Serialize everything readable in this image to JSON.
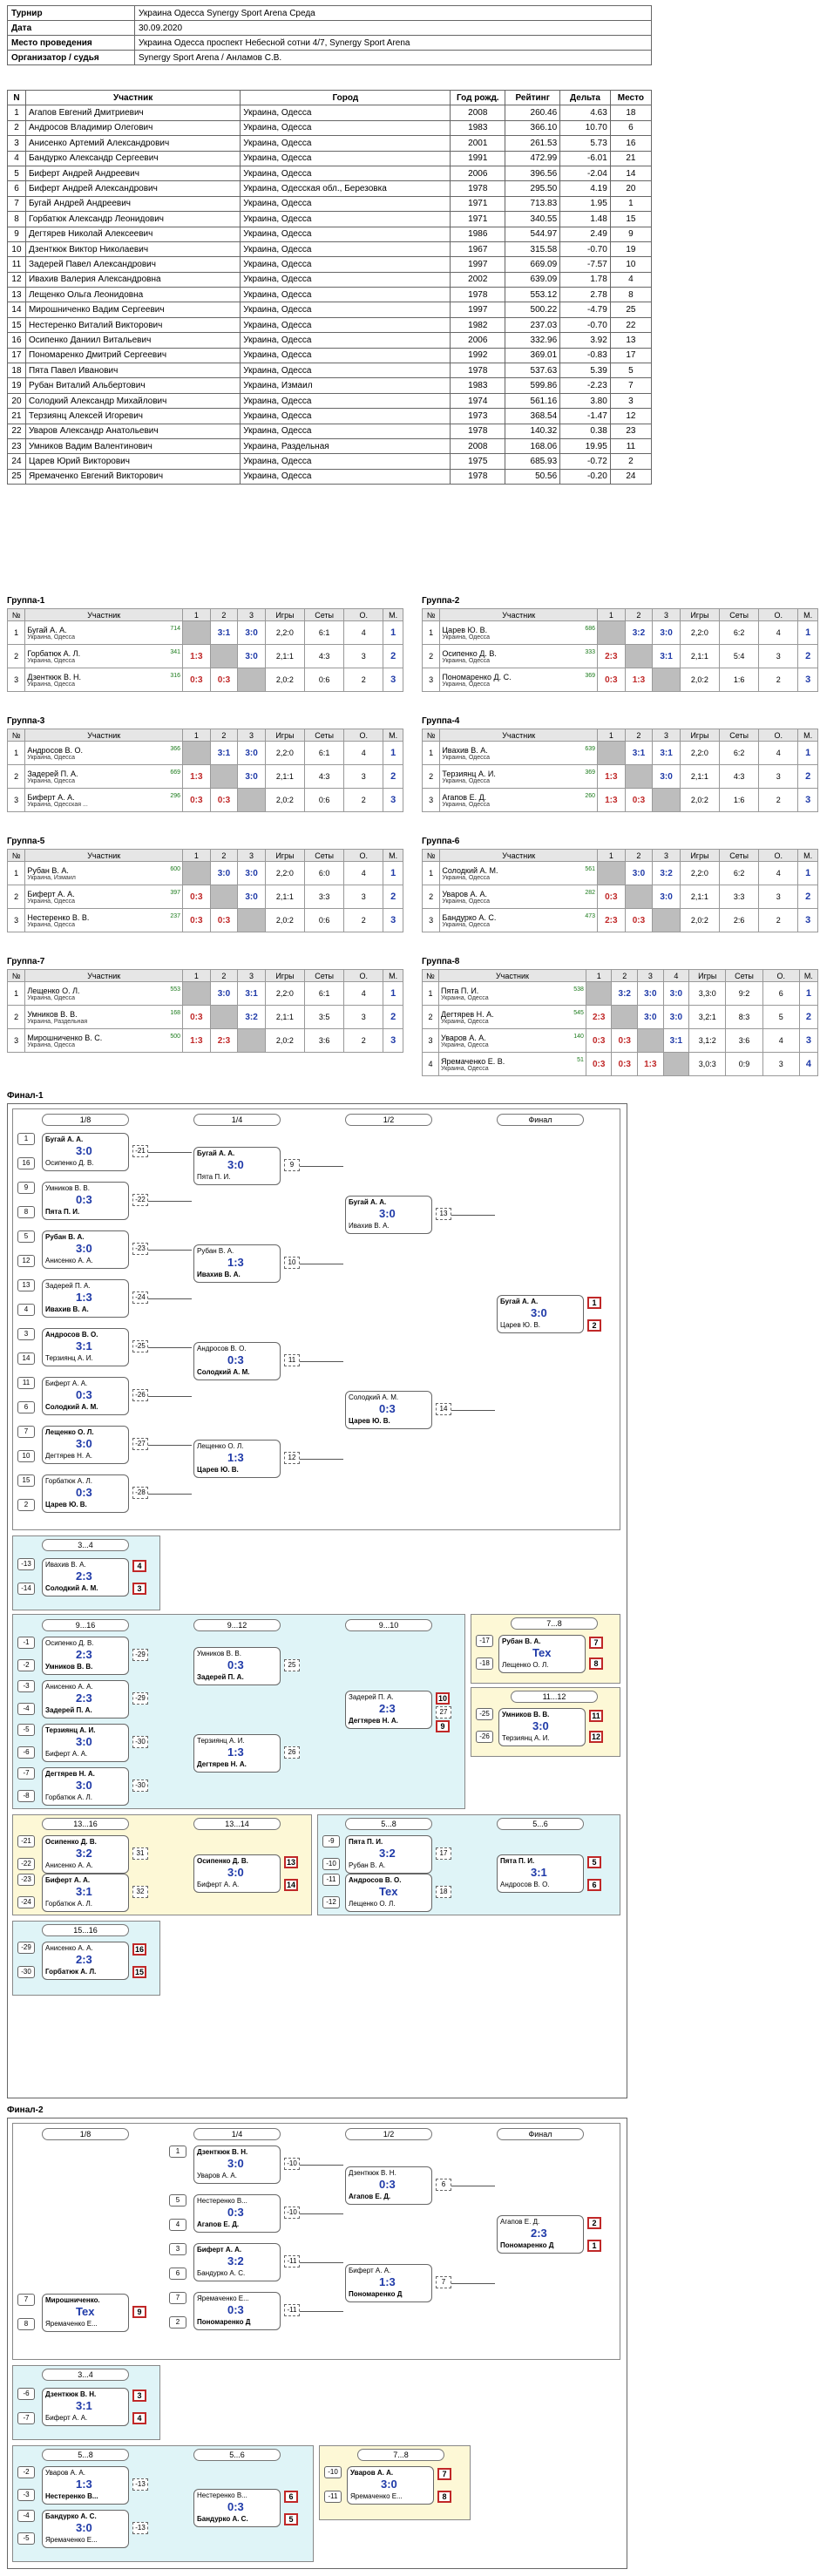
{
  "info": [
    {
      "k": "Турнир",
      "v": "Украина Одесса Synergy Sport Arena Среда"
    },
    {
      "k": "Дата",
      "v": "30.09.2020"
    },
    {
      "k": "Место проведения",
      "v": "Украина Одесса проспект Небесной сотни 4/7, Synergy Sport Arena"
    },
    {
      "k": "Организатор / судья",
      "v": "Synergy Sport Arena / Анламов С.В."
    }
  ],
  "table": {
    "headers": [
      "N",
      "Участник",
      "Город",
      "Год рожд.",
      "Рейтинг",
      "Дельта",
      "Место"
    ],
    "rows": [
      [
        "1",
        "Агапов Евгений Дмитриевич",
        "Украина, Одесса",
        "2008",
        "260.46",
        "4.63",
        "18"
      ],
      [
        "2",
        "Андросов Владимир Олегович",
        "Украина, Одесса",
        "1983",
        "366.10",
        "10.70",
        "6"
      ],
      [
        "3",
        "Анисенко Артемий Александрович",
        "Украина, Одесса",
        "2001",
        "261.53",
        "5.73",
        "16"
      ],
      [
        "4",
        "Бандурко Александр Сергеевич",
        "Украина, Одесса",
        "1991",
        "472.99",
        "-6.01",
        "21"
      ],
      [
        "5",
        "Биферт Андрей Андреевич",
        "Украина, Одесса",
        "2006",
        "396.56",
        "-2.04",
        "14"
      ],
      [
        "6",
        "Биферт Андрей Александрович",
        "Украина, Одесская обл., Березовка",
        "1978",
        "295.50",
        "4.19",
        "20"
      ],
      [
        "7",
        "Бугай Андрей Андреевич",
        "Украина, Одесса",
        "1971",
        "713.83",
        "1.95",
        "1"
      ],
      [
        "8",
        "Горбатюк Александр Леонидович",
        "Украина, Одесса",
        "1971",
        "340.55",
        "1.48",
        "15"
      ],
      [
        "9",
        "Дегтярев Николай Алексеевич",
        "Украина, Одесса",
        "1986",
        "544.97",
        "2.49",
        "9"
      ],
      [
        "10",
        "Дзенткюк Виктор Николаевич",
        "Украина, Одесса",
        "1967",
        "315.58",
        "-0.70",
        "19"
      ],
      [
        "11",
        "Задерей Павел Александрович",
        "Украина, Одесса",
        "1997",
        "669.09",
        "-7.57",
        "10"
      ],
      [
        "12",
        "Ивахив Валерия Александровна",
        "Украина, Одесса",
        "2002",
        "639.09",
        "1.78",
        "4"
      ],
      [
        "13",
        "Лещенко Ольга Леонидовна",
        "Украина, Одесса",
        "1978",
        "553.12",
        "2.78",
        "8"
      ],
      [
        "14",
        "Мирошниченко Вадим Сергеевич",
        "Украина, Одесса",
        "1997",
        "500.22",
        "-4.79",
        "25"
      ],
      [
        "15",
        "Нестеренко Виталий Викторович",
        "Украина, Одесса",
        "1982",
        "237.03",
        "-0.70",
        "22"
      ],
      [
        "16",
        "Осипенко Даниил Витальевич",
        "Украина, Одесса",
        "2006",
        "332.96",
        "3.92",
        "13"
      ],
      [
        "17",
        "Пономаренко Дмитрий Сергеевич",
        "Украина, Одесса",
        "1992",
        "369.01",
        "-0.83",
        "17"
      ],
      [
        "18",
        "Пята Павел Иванович",
        "Украина, Одесса",
        "1978",
        "537.63",
        "5.39",
        "5"
      ],
      [
        "19",
        "Рубан Виталий Альбертович",
        "Украина, Измаил",
        "1983",
        "599.86",
        "-2.23",
        "7"
      ],
      [
        "20",
        "Солодкий Александр Михайлович",
        "Украина, Одесса",
        "1974",
        "561.16",
        "3.80",
        "3"
      ],
      [
        "21",
        "Терзиянц Алексей Игоревич",
        "Украина, Одесса",
        "1973",
        "368.54",
        "-1.47",
        "12"
      ],
      [
        "22",
        "Уваров Александр Анатольевич",
        "Украина, Одесса",
        "1978",
        "140.32",
        "0.38",
        "23"
      ],
      [
        "23",
        "Умников Вадим Валентинович",
        "Украина, Раздельная",
        "2008",
        "168.06",
        "19.95",
        "11"
      ],
      [
        "24",
        "Царев Юрий Викторович",
        "Украина, Одесса",
        "1975",
        "685.93",
        "-0.72",
        "2"
      ],
      [
        "25",
        "Яремаченко Евгений Викторович",
        "Украина, Одесса",
        "1978",
        "50.56",
        "-0.20",
        "24"
      ]
    ]
  },
  "groups": [
    {
      "title": "Группа-1",
      "players": [
        {
          "n": "1",
          "name": "Бугай А. А.",
          "region": "Украина, Одесса",
          "rating": "714",
          "r": [
            "",
            "3:1",
            "3:0"
          ],
          "games": "2,2:0",
          "sets": "6:1",
          "pts": "4",
          "place": "1"
        },
        {
          "n": "2",
          "name": "Горбатюк А. Л.",
          "region": "Украина, Одесса",
          "rating": "341",
          "r": [
            "1:3",
            "",
            "3:0"
          ],
          "games": "2,1:1",
          "sets": "4:3",
          "pts": "3",
          "place": "2"
        },
        {
          "n": "3",
          "name": "Дзенткюк В. Н.",
          "region": "Украина, Одесса",
          "rating": "316",
          "r": [
            "0:3",
            "0:3",
            ""
          ],
          "games": "2,0:2",
          "sets": "0:6",
          "pts": "2",
          "place": "3"
        }
      ]
    },
    {
      "title": "Группа-2",
      "players": [
        {
          "n": "1",
          "name": "Царев Ю. В.",
          "region": "Украина, Одесса",
          "rating": "686",
          "r": [
            "",
            "3:2",
            "3:0"
          ],
          "games": "2,2:0",
          "sets": "6:2",
          "pts": "4",
          "place": "1"
        },
        {
          "n": "2",
          "name": "Осипенко Д. В.",
          "region": "Украина, Одесса",
          "rating": "333",
          "r": [
            "2:3",
            "",
            "3:1"
          ],
          "games": "2,1:1",
          "sets": "5:4",
          "pts": "3",
          "place": "2"
        },
        {
          "n": "3",
          "name": "Пономаренко Д. С.",
          "region": "Украина, Одесса",
          "rating": "369",
          "r": [
            "0:3",
            "1:3",
            ""
          ],
          "games": "2,0:2",
          "sets": "1:6",
          "pts": "2",
          "place": "3"
        }
      ]
    },
    {
      "title": "Группа-3",
      "players": [
        {
          "n": "1",
          "name": "Андросов В. О.",
          "region": "Украина, Одесса",
          "rating": "366",
          "r": [
            "",
            "3:1",
            "3:0"
          ],
          "games": "2,2:0",
          "sets": "6:1",
          "pts": "4",
          "place": "1"
        },
        {
          "n": "2",
          "name": "Задерей П. А.",
          "region": "Украина, Одесса",
          "rating": "669",
          "r": [
            "1:3",
            "",
            "3:0"
          ],
          "games": "2,1:1",
          "sets": "4:3",
          "pts": "3",
          "place": "2"
        },
        {
          "n": "3",
          "name": "Биферт А. А.",
          "region": "Украина, Одесская ...",
          "rating": "296",
          "r": [
            "0:3",
            "0:3",
            ""
          ],
          "games": "2,0:2",
          "sets": "0:6",
          "pts": "2",
          "place": "3"
        }
      ]
    },
    {
      "title": "Группа-4",
      "players": [
        {
          "n": "1",
          "name": "Ивахив В. А.",
          "region": "Украина, Одесса",
          "rating": "639",
          "r": [
            "",
            "3:1",
            "3:1"
          ],
          "games": "2,2:0",
          "sets": "6:2",
          "pts": "4",
          "place": "1"
        },
        {
          "n": "2",
          "name": "Терзиянц А. И.",
          "region": "Украина, Одесса",
          "rating": "369",
          "r": [
            "1:3",
            "",
            "3:0"
          ],
          "games": "2,1:1",
          "sets": "4:3",
          "pts": "3",
          "place": "2"
        },
        {
          "n": "3",
          "name": "Агапов Е. Д.",
          "region": "Украина, Одесса",
          "rating": "260",
          "r": [
            "1:3",
            "0:3",
            ""
          ],
          "games": "2,0:2",
          "sets": "1:6",
          "pts": "2",
          "place": "3"
        }
      ]
    },
    {
      "title": "Группа-5",
      "players": [
        {
          "n": "1",
          "name": "Рубан В. А.",
          "region": "Украина, Измаил",
          "rating": "600",
          "r": [
            "",
            "3:0",
            "3:0"
          ],
          "games": "2,2:0",
          "sets": "6:0",
          "pts": "4",
          "place": "1"
        },
        {
          "n": "2",
          "name": "Биферт А. А.",
          "region": "Украина, Одесса",
          "rating": "397",
          "r": [
            "0:3",
            "",
            "3:0"
          ],
          "games": "2,1:1",
          "sets": "3:3",
          "pts": "3",
          "place": "2"
        },
        {
          "n": "3",
          "name": "Нестеренко В. В.",
          "region": "Украина, Одесса",
          "rating": "237",
          "r": [
            "0:3",
            "0:3",
            ""
          ],
          "games": "2,0:2",
          "sets": "0:6",
          "pts": "2",
          "place": "3"
        }
      ]
    },
    {
      "title": "Группа-6",
      "players": [
        {
          "n": "1",
          "name": "Солодкий А. М.",
          "region": "Украина, Одесса",
          "rating": "561",
          "r": [
            "",
            "3:0",
            "3:2"
          ],
          "games": "2,2:0",
          "sets": "6:2",
          "pts": "4",
          "place": "1"
        },
        {
          "n": "2",
          "name": "Уваров А. А.",
          "region": "Украина, Одесса",
          "rating": "282",
          "r": [
            "0:3",
            "",
            "3:0"
          ],
          "games": "2,1:1",
          "sets": "3:3",
          "pts": "3",
          "place": "2"
        },
        {
          "n": "3",
          "name": "Бандурко А. С.",
          "region": "Украина, Одесса",
          "rating": "473",
          "r": [
            "2:3",
            "0:3",
            ""
          ],
          "games": "2,0:2",
          "sets": "2:6",
          "pts": "2",
          "place": "3"
        }
      ]
    },
    {
      "title": "Группа-7",
      "players": [
        {
          "n": "1",
          "name": "Лещенко О. Л.",
          "region": "Украина, Одесса",
          "rating": "553",
          "r": [
            "",
            "3:0",
            "3:1"
          ],
          "games": "2,2:0",
          "sets": "6:1",
          "pts": "4",
          "place": "1"
        },
        {
          "n": "2",
          "name": "Умников В. В.",
          "region": "Украина, Раздельная",
          "rating": "168",
          "r": [
            "0:3",
            "",
            "3:2"
          ],
          "games": "2,1:1",
          "sets": "3:5",
          "pts": "3",
          "place": "2"
        },
        {
          "n": "3",
          "name": "Мирошниченко В. С.",
          "region": "Украина, Одесса",
          "rating": "500",
          "r": [
            "1:3",
            "2:3",
            ""
          ],
          "games": "2,0:2",
          "sets": "3:6",
          "pts": "2",
          "place": "3"
        }
      ]
    },
    {
      "title": "Группа-8",
      "players": [
        {
          "n": "1",
          "name": "Пята П. И.",
          "region": "Украина, Одесса",
          "rating": "538",
          "r": [
            "",
            "3:2",
            "3:0",
            "3:0"
          ],
          "games": "3,3:0",
          "sets": "9:2",
          "pts": "6",
          "place": "1"
        },
        {
          "n": "2",
          "name": "Дегтярев Н. А.",
          "region": "Украина, Одесса",
          "rating": "545",
          "r": [
            "2:3",
            "",
            "3:0",
            "3:0"
          ],
          "games": "3,2:1",
          "sets": "8:3",
          "pts": "5",
          "place": "2"
        },
        {
          "n": "3",
          "name": "Уваров А. А.",
          "region": "Украина, Одесса",
          "rating": "140",
          "r": [
            "0:3",
            "0:3",
            "",
            "3:1"
          ],
          "games": "3,1:2",
          "sets": "3:6",
          "pts": "4",
          "place": "3"
        },
        {
          "n": "4",
          "name": "Яремаченко Е. В.",
          "region": "Украина, Одесса",
          "rating": "51",
          "r": [
            "0:3",
            "0:3",
            "1:3",
            ""
          ],
          "games": "3,0:3",
          "sets": "0:9",
          "pts": "3",
          "place": "4"
        }
      ]
    }
  ],
  "final1": {
    "title": "Финал-1",
    "rounds": [
      "1/8",
      "1/4",
      "1/2",
      "Финал"
    ],
    "r16": [
      {
        "s1": "1",
        "s2": "16",
        "a": "Бугай А. А.",
        "b": "Осипенко Д. В.",
        "sc": "3:0",
        "w": "a",
        "no": "-21"
      },
      {
        "s1": "9",
        "s2": "8",
        "a": "Умников В. В.",
        "b": "Пята П. И.",
        "sc": "0:3",
        "w": "b",
        "no": "-22"
      },
      {
        "s1": "5",
        "s2": "12",
        "a": "Рубан В. А.",
        "b": "Анисенко А. А.",
        "sc": "3:0",
        "w": "a",
        "no": "-23"
      },
      {
        "s1": "13",
        "s2": "4",
        "a": "Задерей П. А.",
        "b": "Ивахив В. А.",
        "sc": "1:3",
        "w": "b",
        "no": "-24"
      },
      {
        "s1": "3",
        "s2": "14",
        "a": "Андросов В. О.",
        "b": "Терзиянц А. И.",
        "sc": "3:1",
        "w": "a",
        "no": "-25"
      },
      {
        "s1": "11",
        "s2": "6",
        "a": "Биферт А. А.",
        "b": "Солодкий А. М.",
        "sc": "0:3",
        "w": "b",
        "no": "-26"
      },
      {
        "s1": "7",
        "s2": "10",
        "a": "Лещенко О. Л.",
        "b": "Дегтярев Н. А.",
        "sc": "3:0",
        "w": "a",
        "no": "-27"
      },
      {
        "s1": "15",
        "s2": "2",
        "a": "Горбатюк А. Л.",
        "b": "Царев Ю. В.",
        "sc": "0:3",
        "w": "b",
        "no": "-28"
      }
    ],
    "qf": [
      {
        "a": "Бугай А. А.",
        "b": "Пята П. И.",
        "sc": "3:0",
        "w": "a",
        "no": "9",
        "lno": "-17"
      },
      {
        "a": "Рубан В. А.",
        "b": "Ивахив В. А.",
        "sc": "1:3",
        "w": "b",
        "no": "10",
        "lno": "-17"
      },
      {
        "a": "Андросов В. О.",
        "b": "Солодкий А. М.",
        "sc": "0:3",
        "w": "b",
        "no": "11",
        "lno": "-18"
      },
      {
        "a": "Лещенко О. Л.",
        "b": "Царев Ю. В.",
        "sc": "1:3",
        "w": "b",
        "no": "12",
        "lno": "-18"
      }
    ],
    "sf": [
      {
        "a": "Бугай А. А.",
        "b": "Ивахив В. А.",
        "sc": "3:0",
        "w": "a",
        "no": "13",
        "lno": "-16"
      },
      {
        "a": "Солодкий А. М.",
        "b": "Царев Ю. В.",
        "sc": "0:3",
        "w": "b",
        "no": "14",
        "lno": "-16"
      }
    ],
    "final": {
      "a": "Бугай А. А.",
      "b": "Царев Ю. В.",
      "sc": "3:0",
      "w": "a",
      "p1": "1",
      "p2": "2"
    },
    "third": {
      "title": "3...4",
      "s1": "-13",
      "s2": "-14",
      "a": "Ивахив В. А.",
      "b": "Солодкий А. М.",
      "sc": "2:3",
      "p1": "4",
      "p2": "3"
    }
  },
  "final2": {
    "title": "Финал-2",
    "rounds": [
      "1/8",
      "1/4",
      "1/2",
      "Финал"
    ],
    "r16": [
      {
        "s1": "1",
        "s2": "",
        "a": "Дзенткюк В. Н.",
        "b": "Уваров А. А.",
        "sc": "3:0",
        "w": "a",
        "no": "-10"
      },
      {
        "s1": "5",
        "s2": "4",
        "a": "Нестеренко В...",
        "b": "Агапов Е. Д.",
        "sc": "0:3",
        "w": "b",
        "no": "-10"
      },
      {
        "s1": "3",
        "s2": "6",
        "a": "Биферт А. А.",
        "b": "Бандурко А. С.",
        "sc": "3:2",
        "w": "a",
        "no": "-11"
      },
      {
        "s1": "7",
        "s2": "2",
        "a": "Яремаченко Е...",
        "b": "Пономаренко Д...",
        "sc": "0:3",
        "w": "b",
        "no": "-11"
      }
    ],
    "pre": {
      "s1": "7",
      "s2": "8",
      "a": "Мирошниченко...",
      "b": "Яремаченко Е...",
      "sc": "Tex",
      "no": "9"
    },
    "sf": [
      {
        "a": "Дзенткюк В. Н.",
        "b": "Агапов Е. Д.",
        "sc": "0:3",
        "w": "b",
        "no": "6",
        "lno": "-9"
      },
      {
        "a": "Биферт А. А.",
        "b": "Пономаренко Д...",
        "sc": "1:3",
        "w": "b",
        "no": "7",
        "lno": "-9"
      }
    ],
    "final": {
      "a": "Агапов Е. Д.",
      "b": "Пономаренко Д...",
      "sc": "2:3",
      "w": "b",
      "p1": "2",
      "p2": "1"
    },
    "third": {
      "title": "3...4",
      "s1": "-6",
      "s2": "-7",
      "a": "Дзенткюк В. Н.",
      "b": "Биферт А. А.",
      "sc": "3:1",
      "p1": "3",
      "p2": "4"
    },
    "p58": {
      "title": "5...8",
      "t2": "5...6",
      "m1": {
        "s1": "-2",
        "s2": "-3",
        "a": "Уваров А. А.",
        "b": "Нестеренко В...",
        "sc": "1:3",
        "no": "-13"
      },
      "m2": {
        "s1": "-4",
        "s2": "-5",
        "a": "Бандурко А. С.",
        "b": "Яремаченко Е...",
        "sc": "3:0",
        "no": "-13"
      },
      "f": {
        "a": "Нестеренко В...",
        "b": "Бандурко А. С.",
        "sc": "0:3",
        "p1": "6",
        "p2": "5"
      }
    },
    "p78": {
      "title": "7...8",
      "s1": "-10",
      "s2": "-11",
      "a": "Уваров А. А.",
      "b": "Яремаченко Е...",
      "sc": "3:0",
      "p1": "7",
      "p2": "8"
    }
  },
  "classify": [
    {
      "title": "9...16",
      "t2": "9...12",
      "t3": "9...10"
    },
    {
      "title": "7...8",
      "a": "Рубан В. А.",
      "b": "Лещенко О. Л.",
      "sc": "Tex",
      "p1": "7",
      "p2": "8"
    },
    {
      "title": "11...12",
      "a": "Умников В. В.",
      "b": "Терзиянц А. И.",
      "sc": "3:0",
      "p1": "11",
      "p2": "12"
    },
    {
      "title": "13...16",
      "t2": "13...14"
    },
    {
      "title": "5...8",
      "t2": "5...6"
    },
    {
      "title": "15...16",
      "a": "Анисенко А. А.",
      "b": "Горбатюк А. Л.",
      "sc": "2:3",
      "p1": "16",
      "p2": "15"
    }
  ]
}
